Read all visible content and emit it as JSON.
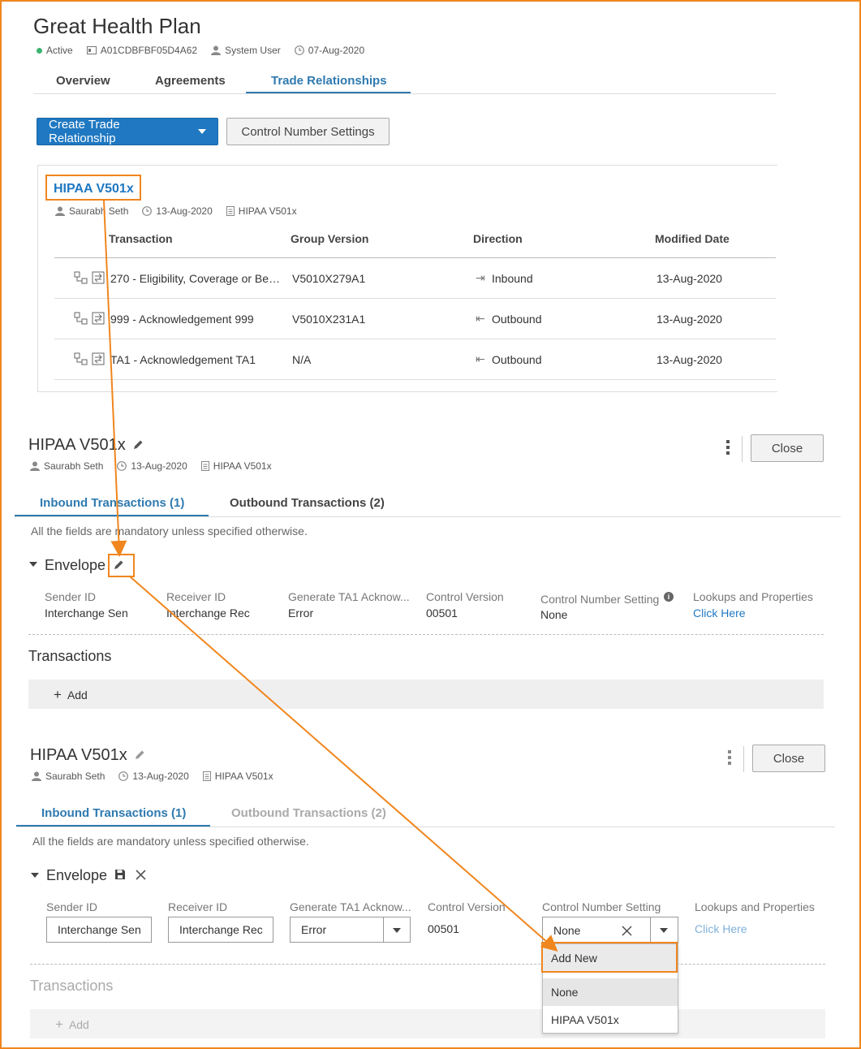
{
  "header": {
    "title": "Great Health Plan",
    "status": "Active",
    "id": "A01CDBFBF05D4A62",
    "user": "System User",
    "date": "07-Aug-2020"
  },
  "main_tabs": [
    "Overview",
    "Agreements",
    "Trade Relationships"
  ],
  "actions": {
    "create_label": "Create Trade Relationship",
    "control_settings_label": "Control Number Settings"
  },
  "card": {
    "title": "HIPAA V501x",
    "author": "Saurabh Seth",
    "date": "13-Aug-2020",
    "version": "HIPAA V501x",
    "columns": [
      "Transaction",
      "Group Version",
      "Direction",
      "Modified Date"
    ],
    "rows": [
      {
        "transaction": "270 - Eligibility, Coverage or Bene...",
        "group_version": "V5010X279A1",
        "direction": "Inbound",
        "modified": "13-Aug-2020"
      },
      {
        "transaction": "999 - Acknowledgement 999",
        "group_version": "V5010X231A1",
        "direction": "Outbound",
        "modified": "13-Aug-2020"
      },
      {
        "transaction": "TA1 - Acknowledgement TA1",
        "group_version": "N/A",
        "direction": "Outbound",
        "modified": "13-Aug-2020"
      }
    ]
  },
  "detail": {
    "title": "HIPAA V501x",
    "author": "Saurabh Seth",
    "date": "13-Aug-2020",
    "version": "HIPAA V501x",
    "close_label": "Close",
    "inbound_tab": "Inbound Transactions (1)",
    "outbound_tab": "Outbound Transactions (2)",
    "mandatory_note": "All the fields are mandatory unless specified otherwise.",
    "envelope_label": "Envelope",
    "fields": {
      "sender_label": "Sender ID",
      "sender_value": "Interchange Sen",
      "receiver_label": "Receiver ID",
      "receiver_value": "Interchange Rec",
      "ta1_label": "Generate TA1 Acknow...",
      "ta1_value": "Error",
      "control_version_label": "Control Version",
      "control_version_value": "00501",
      "control_number_label": "Control Number Setting",
      "control_number_value": "None",
      "lookups_label": "Lookups and Properties",
      "lookups_value": "Click Here"
    },
    "transactions_label": "Transactions",
    "add_label": "Add"
  },
  "dropdown": {
    "options": [
      "Add New",
      "None",
      "HIPAA V501x"
    ]
  },
  "colors": {
    "accent": "#2f7ab0",
    "primary_button": "#1f78c1",
    "highlight": "#f0861e",
    "status_active": "#3cb371"
  }
}
